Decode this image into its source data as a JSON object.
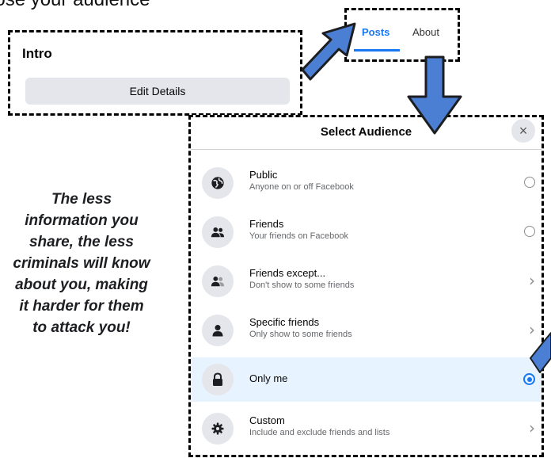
{
  "heading": "oose your audience",
  "intro": {
    "title": "Intro",
    "edit_button": "Edit Details"
  },
  "tabs": [
    {
      "label": "Posts",
      "active": true
    },
    {
      "label": "About",
      "active": false
    }
  ],
  "dialog": {
    "title": "Select Audience",
    "close_label": "×",
    "options": [
      {
        "title": "Public",
        "subtitle": "Anyone on or off Facebook",
        "icon": "globe-icon",
        "control": "radio",
        "selected": false
      },
      {
        "title": "Friends",
        "subtitle": "Your friends on Facebook",
        "icon": "friends-icon",
        "control": "radio",
        "selected": false
      },
      {
        "title": "Friends except...",
        "subtitle": "Don't show to some friends",
        "icon": "friends-except-icon",
        "control": "chevron",
        "selected": false
      },
      {
        "title": "Specific friends",
        "subtitle": "Only show to some friends",
        "icon": "person-icon",
        "control": "chevron",
        "selected": false
      },
      {
        "title": "Only me",
        "subtitle": "",
        "icon": "lock-icon",
        "control": "radio",
        "selected": true
      },
      {
        "title": "Custom",
        "subtitle": "Include and exclude friends and lists",
        "icon": "gear-icon",
        "control": "chevron",
        "selected": false
      }
    ]
  },
  "caption": {
    "lines": [
      "The less",
      "information you",
      "share, the less",
      "criminals will know",
      "about you, making",
      "it harder for them",
      "to attack you!"
    ]
  },
  "colors": {
    "accent": "#1877f2",
    "arrow": "#4a7fd4",
    "selected_row": "#e7f3ff"
  }
}
